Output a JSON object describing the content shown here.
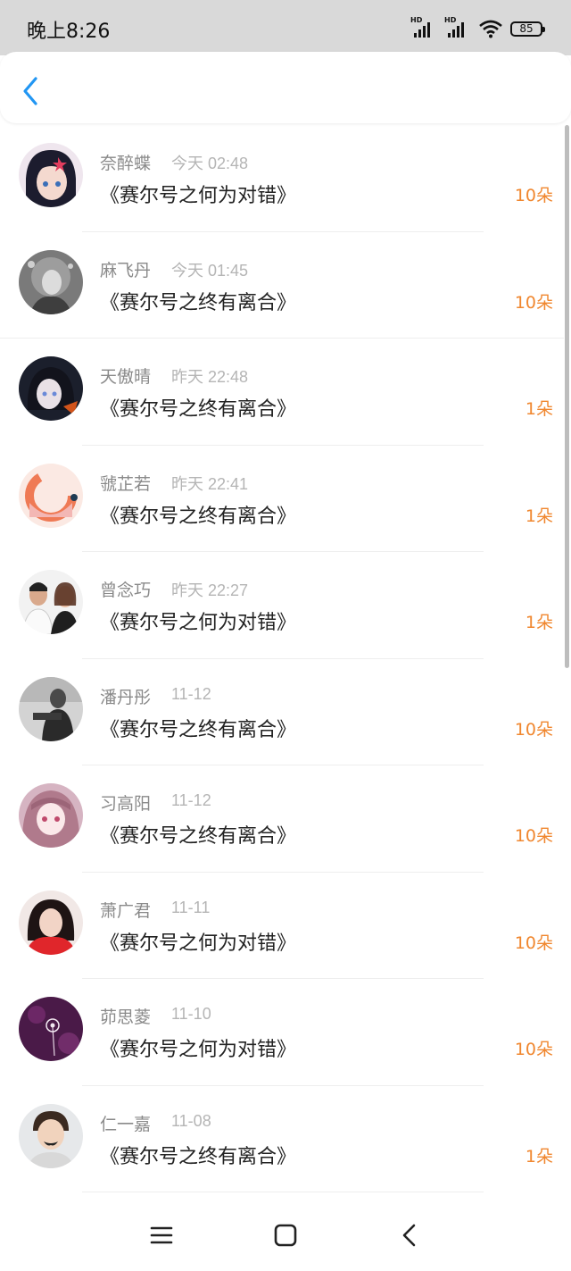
{
  "status": {
    "time": "晚上8:26",
    "signal1": "HD",
    "signal2": "HD",
    "battery": "85"
  },
  "header": {
    "back_icon": "chevron-left-icon",
    "accent": "#2196F3"
  },
  "items": [
    {
      "name": "奈醉蝶",
      "time": "今天 02:48",
      "title": "《赛尔号之何为对错》",
      "flowers": "10朵"
    },
    {
      "name": "麻飞丹",
      "time": "今天 01:45",
      "title": "《赛尔号之终有离合》",
      "flowers": "10朵"
    },
    {
      "name": "天傲晴",
      "time": "昨天 22:48",
      "title": "《赛尔号之终有离合》",
      "flowers": "1朵"
    },
    {
      "name": "虢芷若",
      "time": "昨天 22:41",
      "title": "《赛尔号之终有离合》",
      "flowers": "1朵"
    },
    {
      "name": "曾念巧",
      "time": "昨天 22:27",
      "title": "《赛尔号之何为对错》",
      "flowers": "1朵"
    },
    {
      "name": "潘丹彤",
      "time": "11-12",
      "title": "《赛尔号之终有离合》",
      "flowers": "10朵"
    },
    {
      "name": "习高阳",
      "time": "11-12",
      "title": "《赛尔号之终有离合》",
      "flowers": "10朵"
    },
    {
      "name": "萧广君",
      "time": "11-11",
      "title": "《赛尔号之何为对错》",
      "flowers": "10朵"
    },
    {
      "name": "茆思菱",
      "time": "11-10",
      "title": "《赛尔号之何为对错》",
      "flowers": "10朵"
    },
    {
      "name": "仁一嘉",
      "time": "11-08",
      "title": "《赛尔号之终有离合》",
      "flowers": "1朵"
    }
  ],
  "nav": {
    "menu_icon": "menu-icon",
    "home_icon": "home-square-icon",
    "back_icon": "back-triangle-icon"
  },
  "colors": {
    "flowers": "#f0872f",
    "name": "#8a8a8a",
    "time": "#b5b5b5",
    "title": "#222222"
  }
}
